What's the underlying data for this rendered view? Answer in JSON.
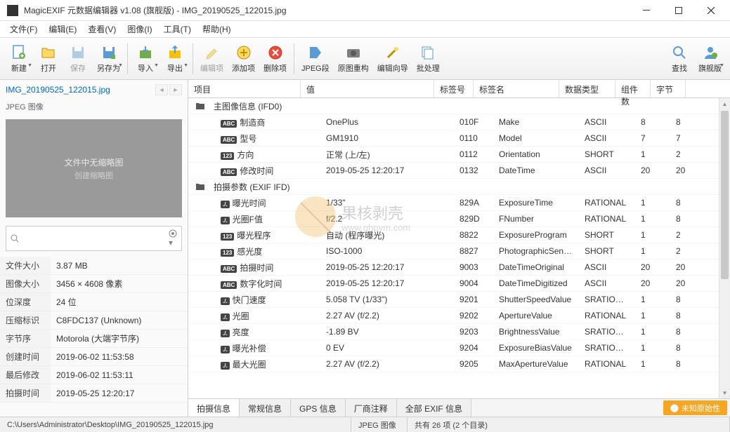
{
  "window": {
    "title": "MagicEXIF 元数据编辑器 v1.08 (旗舰版) - IMG_20190525_122015.jpg"
  },
  "menu": [
    "文件(F)",
    "编辑(E)",
    "查看(V)",
    "图像(I)",
    "工具(T)",
    "帮助(H)"
  ],
  "toolbar": {
    "new": "新建",
    "open": "打开",
    "save": "保存",
    "saveas": "另存为",
    "import": "导入",
    "export": "导出",
    "edititem": "编辑项",
    "additem": "添加项",
    "delitem": "删除项",
    "jpeg": "JPEG段",
    "rebuild": "原图重构",
    "wizard": "编辑向导",
    "batch": "批处理",
    "find": "查找",
    "edition": "旗舰版"
  },
  "left": {
    "filename": "IMG_20190525_122015.jpg",
    "imagetype": "JPEG 图像",
    "thumb_line1": "文件中无缩略图",
    "thumb_line2": "创建缩略图",
    "props": [
      [
        "文件大小",
        "3.87 MB"
      ],
      [
        "图像大小",
        "3456 × 4608 像素"
      ],
      [
        "位深度",
        "24 位"
      ],
      [
        "压缩标识",
        "C8FDC137 (Unknown)"
      ],
      [
        "字节序",
        "Motorola (大端字节序)"
      ],
      [
        "创建时间",
        "2019-06-02 11:53:58"
      ],
      [
        "最后修改",
        "2019-06-02 11:53:11"
      ],
      [
        "拍摄时间",
        "2019-05-25 12:20:17"
      ]
    ]
  },
  "table": {
    "headers": [
      "项目",
      "值",
      "标签号",
      "标签名",
      "数据类型",
      "组件数",
      "字节"
    ],
    "groups": [
      {
        "label": "主图像信息 (IFD0)",
        "rows": [
          {
            "tag": "ABC",
            "name": "制造商",
            "val": "OnePlus",
            "num": "010F",
            "tname": "Make",
            "dtype": "ASCII",
            "comp": "8",
            "bytes": "8"
          },
          {
            "tag": "ABC",
            "name": "型号",
            "val": "GM1910",
            "num": "0110",
            "tname": "Model",
            "dtype": "ASCII",
            "comp": "7",
            "bytes": "7"
          },
          {
            "tag": "123",
            "name": "方向",
            "val": "正常 (上/左)",
            "num": "0112",
            "tname": "Orientation",
            "dtype": "SHORT",
            "comp": "1",
            "bytes": "2"
          },
          {
            "tag": "ABC",
            "name": "修改时间",
            "val": "2019-05-25 12:20:17",
            "num": "0132",
            "tname": "DateTime",
            "dtype": "ASCII",
            "comp": "20",
            "bytes": "20"
          }
        ]
      },
      {
        "label": "拍摄参数 (EXIF IFD)",
        "rows": [
          {
            "tag": "./.",
            "name": "曝光时间",
            "val": "1/33\"",
            "num": "829A",
            "tname": "ExposureTime",
            "dtype": "RATIONAL",
            "comp": "1",
            "bytes": "8"
          },
          {
            "tag": "./.",
            "name": "光圈F值",
            "val": "f/2.2",
            "num": "829D",
            "tname": "FNumber",
            "dtype": "RATIONAL",
            "comp": "1",
            "bytes": "8"
          },
          {
            "tag": "123",
            "name": "曝光程序",
            "val": "自动 (程序曝光)",
            "num": "8822",
            "tname": "ExposureProgram",
            "dtype": "SHORT",
            "comp": "1",
            "bytes": "2"
          },
          {
            "tag": "123",
            "name": "感光度",
            "val": "ISO-1000",
            "num": "8827",
            "tname": "PhotographicSensi...",
            "dtype": "SHORT",
            "comp": "1",
            "bytes": "2"
          },
          {
            "tag": "ABC",
            "name": "拍摄时间",
            "val": "2019-05-25 12:20:17",
            "num": "9003",
            "tname": "DateTimeOriginal",
            "dtype": "ASCII",
            "comp": "20",
            "bytes": "20"
          },
          {
            "tag": "ABC",
            "name": "数字化时间",
            "val": "2019-05-25 12:20:17",
            "num": "9004",
            "tname": "DateTimeDigitized",
            "dtype": "ASCII",
            "comp": "20",
            "bytes": "20"
          },
          {
            "tag": "./.",
            "name": "快门速度",
            "val": "5.058 TV (1/33\")",
            "num": "9201",
            "tname": "ShutterSpeedValue",
            "dtype": "SRATIONAL",
            "comp": "1",
            "bytes": "8"
          },
          {
            "tag": "./.",
            "name": "光圈",
            "val": "2.27 AV (f/2.2)",
            "num": "9202",
            "tname": "ApertureValue",
            "dtype": "RATIONAL",
            "comp": "1",
            "bytes": "8"
          },
          {
            "tag": "./.",
            "name": "亮度",
            "val": "-1.89 BV",
            "num": "9203",
            "tname": "BrightnessValue",
            "dtype": "SRATIONAL",
            "comp": "1",
            "bytes": "8"
          },
          {
            "tag": "./.",
            "name": "曝光补偿",
            "val": "0 EV",
            "num": "9204",
            "tname": "ExposureBiasValue",
            "dtype": "SRATIONAL",
            "comp": "1",
            "bytes": "8"
          },
          {
            "tag": "./.",
            "name": "最大光圈",
            "val": "2.27 AV (f/2.2)",
            "num": "9205",
            "tname": "MaxApertureValue",
            "dtype": "RATIONAL",
            "comp": "1",
            "bytes": "8"
          }
        ]
      }
    ]
  },
  "tabs": [
    "拍摄信息",
    "常规信息",
    "GPS 信息",
    "厂商注释",
    "全部 EXIF 信息"
  ],
  "badge": "未知原始性",
  "status": {
    "path": "C:\\Users\\Administrator\\Desktop\\IMG_20190525_122015.jpg",
    "type": "JPEG 图像",
    "count": "共有 26 项 (2 个目录)"
  },
  "watermark": {
    "text": "果核剥壳",
    "url": "www.ghpym.com"
  }
}
